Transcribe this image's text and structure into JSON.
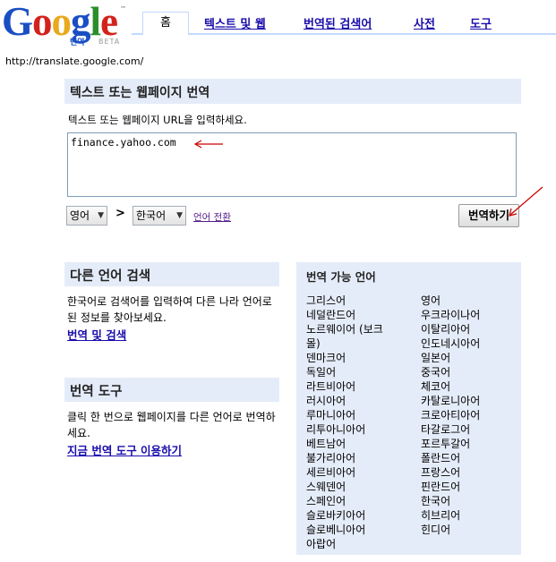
{
  "logo": {
    "word": "Google",
    "tm": "™",
    "sub": "번역",
    "beta": "BETA"
  },
  "tabs": {
    "active": "홈",
    "links": [
      "텍스트 및 웹",
      "번역된 검색어",
      "사전",
      "도구"
    ]
  },
  "url_text": "http://translate.google.com/",
  "main": {
    "title": "텍스트 또는 웹페이지 번역",
    "hint": "텍스트 또는 웹페이지 URL을 입력하세요.",
    "input_value": "finance.yahoo.com",
    "source_lang": "영어",
    "separator": ">",
    "target_lang": "한국어",
    "swap_label": "언어 전환",
    "translate_button": "번역하기"
  },
  "search_box": {
    "title": "다른 언어 검색",
    "text": "한국어로 검색어를 입력하여 다른 나라 언어로 된 정보를 찾아보세요.",
    "link": "번역 및 검색"
  },
  "tools_box": {
    "title": "번역 도구",
    "text": "클릭 한 번으로 웹페이지를 다른 언어로 번역하세요.",
    "link": "지금 번역 도구 이용하기"
  },
  "languages": {
    "title": "번역 가능 언어",
    "col1": [
      "그리스어",
      "네덜란드어",
      "노르웨이어 (보크",
      "몰)",
      "덴마크어",
      "독일어",
      "라트비아어",
      "러시아어",
      "루마니아어",
      "리투아니아어",
      "베트남어",
      "불가리아어",
      "세르비아어",
      "스웨덴어",
      "스페인어",
      "슬로바키아어",
      "슬로베니아어",
      "아랍어"
    ],
    "col2": [
      "영어",
      "우크라이나어",
      "이탈리아어",
      "인도네시아어",
      "일본어",
      "중국어",
      "체코어",
      "카탈로니아어",
      "크로아티아어",
      "타갈로그어",
      "포르투갈어",
      "폴란드어",
      "프랑스어",
      "핀란드어",
      "한국어",
      "히브리어",
      "힌디어"
    ]
  },
  "colors": {
    "accent_bar": "#e5ecf9",
    "tab_border": "#c3d9ff",
    "link": "#1a0dab",
    "annotation": "#cc0000"
  }
}
